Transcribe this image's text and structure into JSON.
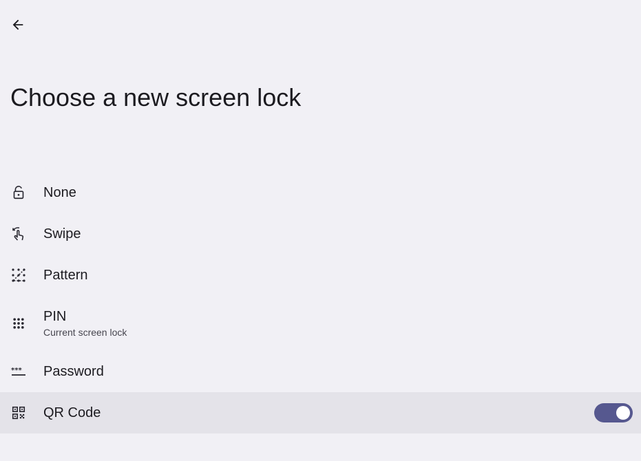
{
  "header": {
    "back_icon": "arrow-back-icon",
    "title": "Choose a new screen lock"
  },
  "options": [
    {
      "id": "none",
      "label": "None",
      "icon": "lock-open-icon"
    },
    {
      "id": "swipe",
      "label": "Swipe",
      "icon": "swipe-icon"
    },
    {
      "id": "pattern",
      "label": "Pattern",
      "icon": "pattern-icon"
    },
    {
      "id": "pin",
      "label": "PIN",
      "subtitle": "Current screen lock",
      "icon": "dialpad-icon"
    },
    {
      "id": "password",
      "label": "Password",
      "icon": "password-icon"
    },
    {
      "id": "qr",
      "label": "QR Code",
      "icon": "qr-code-icon",
      "toggle_on": true
    }
  ],
  "colors": {
    "background": "#f1f0f5",
    "highlight": "#e4e3e9",
    "toggle_track": "#56588f",
    "text": "#1c1b20"
  }
}
